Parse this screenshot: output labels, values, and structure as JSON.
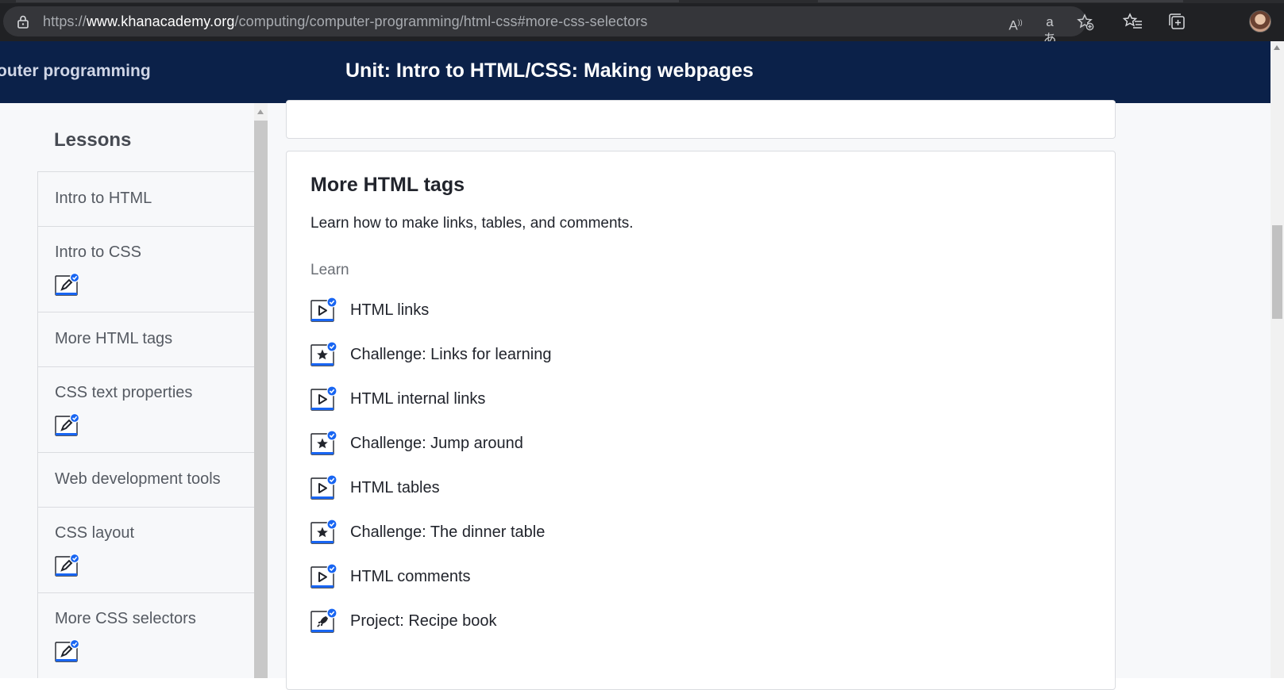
{
  "browser": {
    "url_prefix": "https://",
    "url_host": "www.khanacademy.org",
    "url_path": "/computing/computer-programming/html-css#more-css-selectors",
    "toolbar_icons": [
      "read-aloud-icon",
      "translate-icon",
      "add-favorite-icon",
      "favorites-icon",
      "collections-icon",
      "profile-avatar"
    ]
  },
  "header": {
    "breadcrumb": "outer programming",
    "unit_title": "Unit: Intro to HTML/CSS: Making webpages",
    "background": "#0b2149"
  },
  "sidebar": {
    "heading": "Lessons",
    "items": [
      {
        "label": "Intro to HTML",
        "has_badge": false
      },
      {
        "label": "Intro to CSS",
        "has_badge": true
      },
      {
        "label": "More HTML tags",
        "has_badge": false
      },
      {
        "label": "CSS text properties",
        "has_badge": true
      },
      {
        "label": "Web development tools",
        "has_badge": false
      },
      {
        "label": "CSS layout",
        "has_badge": true
      },
      {
        "label": "More CSS selectors",
        "has_badge": true
      }
    ]
  },
  "lesson": {
    "title": "More HTML tags",
    "description": "Learn how to make links, tables, and comments.",
    "section_label": "Learn",
    "items": [
      {
        "label": "HTML links",
        "type": "video"
      },
      {
        "label": "Challenge: Links for learning",
        "type": "challenge"
      },
      {
        "label": "HTML internal links",
        "type": "video"
      },
      {
        "label": "Challenge: Jump around",
        "type": "challenge"
      },
      {
        "label": "HTML tables",
        "type": "video"
      },
      {
        "label": "Challenge: The dinner table",
        "type": "challenge"
      },
      {
        "label": "HTML comments",
        "type": "video"
      },
      {
        "label": "Project: Recipe book",
        "type": "project"
      }
    ]
  },
  "colors": {
    "accent_blue": "#1865f2",
    "check_blue": "#1865f2",
    "text_dark": "#21242c"
  }
}
